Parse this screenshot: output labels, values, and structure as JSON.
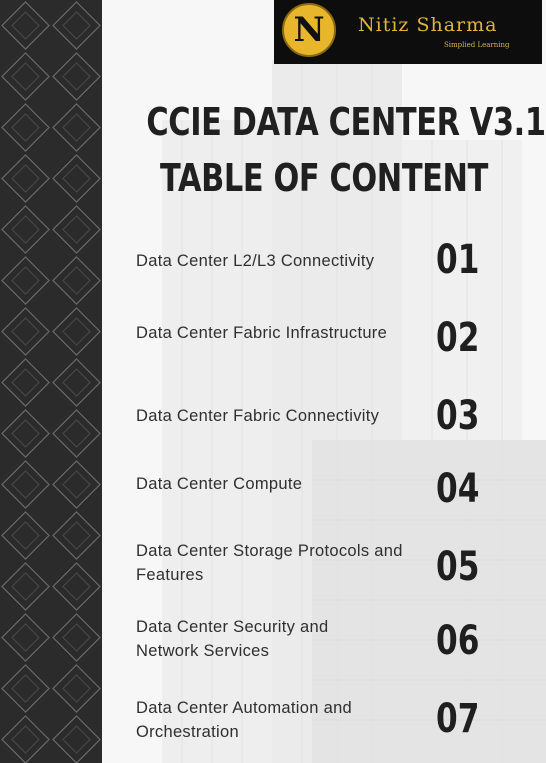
{
  "brand": {
    "logo_letter": "N",
    "name": "Nitiz Sharma",
    "tagline": "Simplied Learning",
    "accent_color": "#e1b53b"
  },
  "title": {
    "line1": "CCIE DATA CENTER V3.1",
    "line2": "TABLE OF CONTENT"
  },
  "toc": [
    {
      "label": "Data Center L2/L3 Connectivity",
      "number": "01"
    },
    {
      "label": "Data Center Fabric Infrastructure",
      "number": "02"
    },
    {
      "label": "Data Center Fabric Connectivity",
      "number": "03"
    },
    {
      "label": "Data Center Compute",
      "number": "04"
    },
    {
      "label": "Data Center Storage Protocols and Features",
      "number": "05"
    },
    {
      "label": "Data Center Security and Network Services",
      "number": "06"
    },
    {
      "label": "Data Center Automation and Orchestration",
      "number": "07"
    }
  ]
}
